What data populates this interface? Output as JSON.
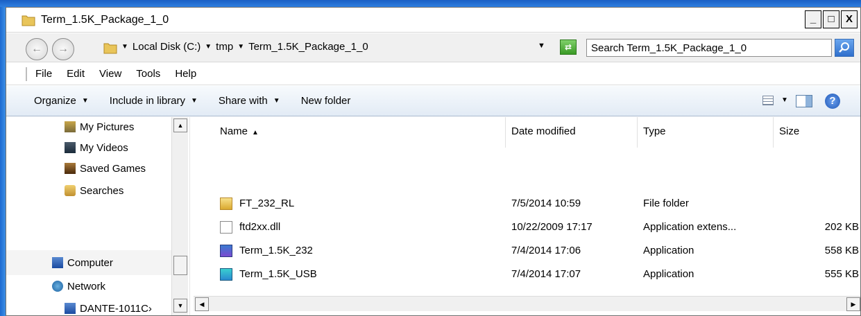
{
  "window": {
    "title": "Term_1.5K_Package_1_0"
  },
  "controls": {
    "minimize": "_",
    "maximize": "□",
    "close": "X"
  },
  "address": {
    "crumbs": [
      "Local Disk (C:)",
      "tmp",
      "Term_1.5K_Package_1_0"
    ],
    "search_placeholder": "Search Term_1.5K_Package_1_0"
  },
  "menu": [
    "File",
    "Edit",
    "View",
    "Tools",
    "Help"
  ],
  "commands": {
    "organize": "Organize",
    "include": "Include in library",
    "share": "Share with",
    "new_folder": "New folder"
  },
  "nav": {
    "items": [
      {
        "label": "My Pictures",
        "icon": "pictures-icon"
      },
      {
        "label": "My Videos",
        "icon": "videos-icon"
      },
      {
        "label": "Saved Games",
        "icon": "saved-games-icon"
      },
      {
        "label": "Searches",
        "icon": "searches-icon"
      },
      {
        "label": "Computer",
        "icon": "computer-icon"
      },
      {
        "label": "Network",
        "icon": "network-icon"
      },
      {
        "label": "DANTE-1011C›",
        "icon": "computer-icon"
      }
    ]
  },
  "columns": {
    "name": "Name",
    "date": "Date modified",
    "type": "Type",
    "size": "Size"
  },
  "files": [
    {
      "name": "FT_232_RL",
      "date": "7/5/2014 10:59",
      "type": "File folder",
      "size": "",
      "icon": "folder-icon"
    },
    {
      "name": "ftd2xx.dll",
      "date": "10/22/2009 17:17",
      "type": "Application extens...",
      "size": "202 KB",
      "icon": "dll-icon"
    },
    {
      "name": "Term_1.5K_232",
      "date": "7/4/2014 17:06",
      "type": "Application",
      "size": "558 KB",
      "icon": "app-icon"
    },
    {
      "name": "Term_1.5K_USB",
      "date": "7/4/2014 17:07",
      "type": "Application",
      "size": "555 KB",
      "icon": "usb-app-icon"
    }
  ]
}
